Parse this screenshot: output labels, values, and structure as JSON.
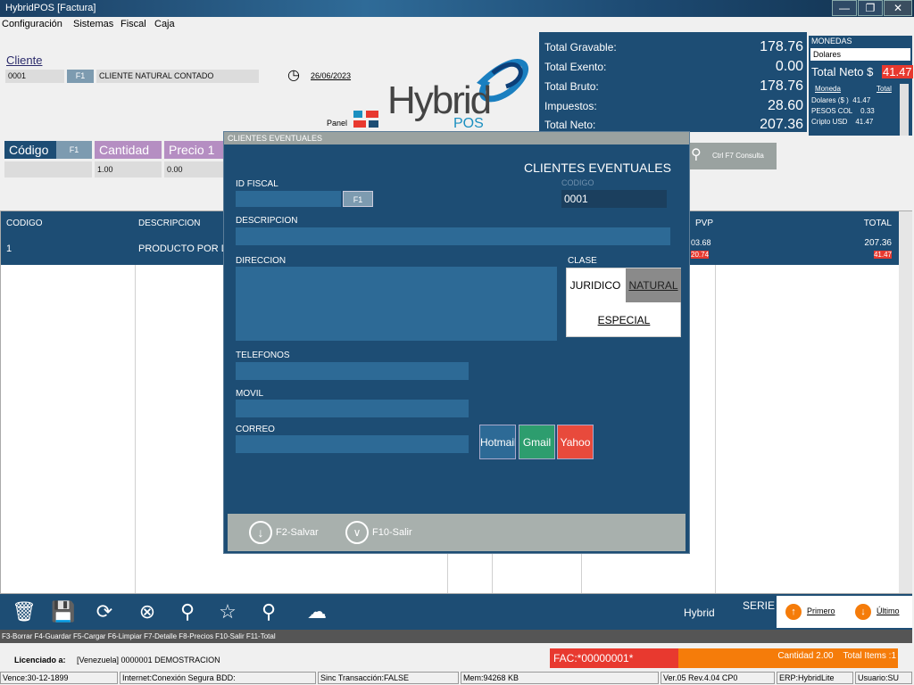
{
  "window": {
    "title": "HybridPOS [Factura]"
  },
  "menu": [
    "Configuración",
    "Sistemas",
    "Fiscal",
    "Caja"
  ],
  "header": {
    "cliente_label": "Cliente",
    "cliente_code": "0001",
    "f1": "F1",
    "cliente_name": "CLIENTE NATURAL CONTADO",
    "date": "26/06/2023",
    "panel": "Panel"
  },
  "brand": {
    "hybrid": "Hybrid",
    "pos": "POS"
  },
  "totals": [
    {
      "label": "Total Gravable:",
      "value": "178.76"
    },
    {
      "label": "Total Exento:",
      "value": "0.00"
    },
    {
      "label": "Total Bruto:",
      "value": "178.76"
    },
    {
      "label": "Impuestos:",
      "value": "28.60"
    },
    {
      "label": "Total Neto:",
      "value": "207.36"
    }
  ],
  "monedas": {
    "title": "MONEDAS",
    "selected": "Dolares",
    "total_neto_label": "Total Neto $",
    "total_neto_value": "41.47",
    "col_moneda": "Moneda",
    "col_total": "Total",
    "rows": [
      {
        "m": "Dolares ($ )",
        "t": "41.47"
      },
      {
        "m": "PESOS COL",
        "t": "0.33"
      },
      {
        "m": "Cripto USD",
        "t": "41.47"
      }
    ]
  },
  "inputs": {
    "codigo": "Código",
    "f1": "F1",
    "cantidad": "Cantidad",
    "precio": "Precio 1",
    "cantidad_val": "1.00",
    "precio_val": "0.00",
    "consulta": "Ctrl F7 Consulta"
  },
  "grid": {
    "headers": {
      "codigo": "CODIGO",
      "descripcion": "DESCRIPCION",
      "pvp": "PVP",
      "total": "TOTAL"
    },
    "row": {
      "codigo": "1",
      "descripcion": "PRODUCTO POR D",
      "pvp": "03.68",
      "pvp2": "20.74",
      "total": "207.36",
      "total2": "41.47"
    }
  },
  "fkeys": "F3-Borrar F4-Guardar F5-Cargar  F6-Limpiar F7-Detalle F8-Precios  F10-Salir  F11-Total",
  "serie": "SERIE",
  "nav": {
    "primero": "Primero",
    "ultimo": "Último"
  },
  "license": {
    "label": "Licenciado a:",
    "value": "[Venezuela] 0000001 DEMOSTRACION"
  },
  "factura": "FAC:*00000001*",
  "cantidad_info": "Cantidad 2.00    Total Items :1",
  "status": [
    "Vence:30-12-1899",
    "Internet:Conexión Segura BDD:",
    "Sinc Transacción:FALSE",
    "Mem:94268 KB",
    "Ver.05 Rev.4.04 CP0",
    "ERP:HybridLite",
    "Usuario:SU"
  ],
  "dialog": {
    "title": "CLIENTES EVENTUALES",
    "heading": "CLIENTES EVENTUALES",
    "id_fiscal": "ID FISCAL",
    "f1": "F1",
    "codigo_label": "CODIGO",
    "codigo_value": "0001",
    "descripcion": "DESCRIPCION",
    "direccion": "DIRECCION",
    "clase": "CLASE",
    "juridico": "JURIDICO",
    "natural": "NATURAL",
    "especial": "ESPECIAL",
    "telefonos": "TELEFONOS",
    "movil": "MOVIL",
    "correo": "CORREO",
    "hotmail": "Hotmail",
    "gmail": "Gmail",
    "yahoo": "Yahoo",
    "salvar": "F2-Salvar",
    "salir": "F10-Salir"
  },
  "colors": {
    "navy": "#1d4d74",
    "red": "#e8392f",
    "orange": "#f57c0a",
    "green": "#2d9d6e",
    "purple": "#b58ec2"
  }
}
